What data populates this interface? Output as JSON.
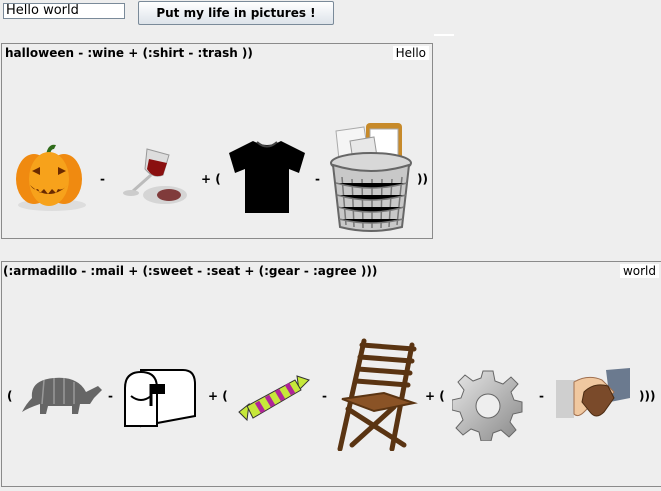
{
  "input": {
    "value": "Hello world"
  },
  "button": {
    "label": "Put my life in pictures !"
  },
  "panels": [
    {
      "title": "halloween - :wine + (:shirt - :trash ))",
      "tag": "Hello",
      "ops": [
        "-",
        "+ (",
        "-",
        "))"
      ],
      "icons": [
        "pumpkin-icon",
        "wine-glass-icon",
        "shirt-icon",
        "trash-icon"
      ]
    },
    {
      "title": "(:armadillo - :mail + (:sweet - :seat + (:gear - :agree )))",
      "tag": "world",
      "ops": [
        "(",
        "-",
        "+ (",
        "-",
        "+ (",
        "-",
        ")))"
      ],
      "icons": [
        "armadillo-icon",
        "mailbox-icon",
        "candy-icon",
        "chair-icon",
        "gear-icon",
        "handshake-icon"
      ]
    }
  ]
}
